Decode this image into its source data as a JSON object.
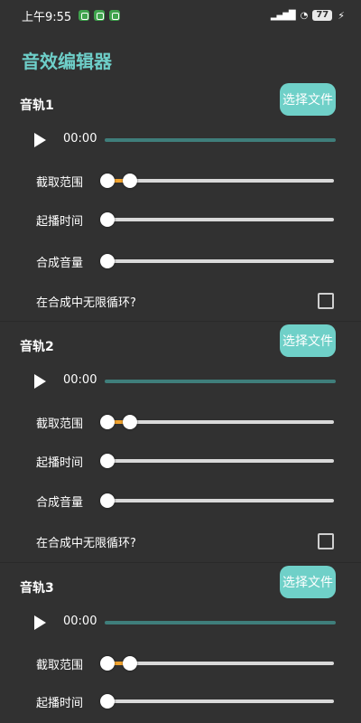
{
  "status_bar": {
    "time": "上午9:55",
    "battery": "77"
  },
  "app": {
    "title": "音效编辑器"
  },
  "labels": {
    "choose_file": "选择文件",
    "play_time": "00:00",
    "crop_range": "截取范围",
    "start_time": "起播时间",
    "mix_volume": "合成音量",
    "loop": "在合成中无限循环?"
  },
  "tracks": [
    {
      "name": "音轨1",
      "crop_range": [
        0,
        0.1
      ],
      "start_time": 0,
      "mix_volume": 0,
      "loop": false
    },
    {
      "name": "音轨2",
      "crop_range": [
        0,
        0.1
      ],
      "start_time": 0,
      "mix_volume": 0,
      "loop": false
    },
    {
      "name": "音轨3",
      "crop_range": [
        0,
        0.1
      ],
      "start_time": 0
    }
  ],
  "colors": {
    "accent": "#6fd0c8",
    "title": "#6ecfc9",
    "range_fill": "#f0a22d",
    "background": "#313131"
  }
}
